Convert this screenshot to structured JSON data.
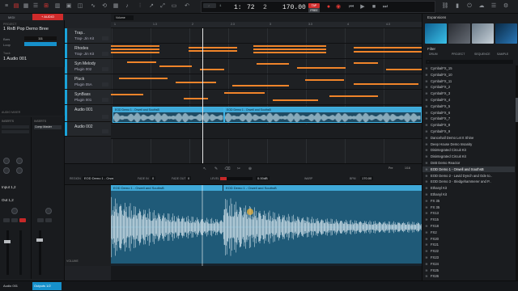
{
  "topbar": {
    "midi_tab": "MIDI",
    "audio_tab": "+ AUDIO",
    "volume_label": "Volume",
    "bars": "1:",
    "beats": "72",
    "ticks": "2",
    "bar_small": "1",
    "bpm": "170.00",
    "tap_label": "TAP",
    "tempo_label": "FREE",
    "accent": "#d12e2e"
  },
  "left": {
    "project_label": "1 RnB Pop Demo Bree",
    "bars_label": "Bars",
    "bars_value": "111",
    "loop_label": "Loop",
    "track_label": "Track",
    "track_value": "1 Audio 001",
    "inserts1": "INSERTS",
    "inserts2": "INSERTS",
    "comp_label": "Comp Master",
    "input_label": "Input 1,2",
    "out_label": "Out 1,2",
    "audio_mixer_label": "AUDIO MIXER"
  },
  "tracks": [
    {
      "name": "Trap..",
      "sub": "Trap-.Jin Kit",
      "color": "#1aa3d9"
    },
    {
      "name": "Rhodes",
      "sub": "Trap-.Jin Kit",
      "color": "#1aa3d9"
    },
    {
      "name": "Syn Melody",
      "sub": "Plugin 002",
      "color": "#1aa3d9"
    },
    {
      "name": "Pluck",
      "sub": "Plugin 05A",
      "color": "#1aa3d9"
    },
    {
      "name": "SynBass",
      "sub": "Plugin 001",
      "color": "#1aa3d9"
    },
    {
      "name": "Audio 001",
      "sub": "",
      "color": "#1aa3d9"
    },
    {
      "name": "Audio 002",
      "sub": "",
      "color": "#1aa3d9"
    }
  ],
  "sequencer": {
    "ruler": [
      "1",
      "1.3",
      "2",
      "2.3",
      "3",
      "3.3",
      "4",
      "4.3"
    ],
    "clip1": "EOD Demo 1 - Orwell and SouthsB",
    "clip2": "EOD Demo 1 - Orwell and SouthsB",
    "audio_label": "AUDIO",
    "programs_label": "PROGRAMS"
  },
  "editbar": {
    "region_label": "REGION",
    "region_value": "EOD Demo 1 - Orwell and ...",
    "fade_in_label": "FADE IN",
    "fade_in_value": "0",
    "fade_out_label": "FADE OUT",
    "fade_out_value": "0",
    "level_label": "LEVEL",
    "level_value": "0.00dB",
    "warp_label": "WARP",
    "bpm_label": "BPM",
    "bpm_value": "170.00",
    "mode": "Pre",
    "rate": "1/16"
  },
  "editor": {
    "clip1": "EOD Demo 1 - Orwell and SouthsB",
    "clip2": "EOD Demo 1 - Orwell and SouthsB",
    "volume_label": "VOLUME"
  },
  "footer": {
    "left": "Audio 001",
    "mid": "Outputs 1/2"
  },
  "right": {
    "expansions_label": "Expansions",
    "filter_label": "Filter",
    "filter_tabs": [
      "DRUM",
      "PROJECT",
      "SEQUENCE",
      "SAMPLE"
    ],
    "path": "..",
    "items": [
      {
        "label": "CymbalFX_15",
        "icon": "wave"
      },
      {
        "label": "CymbalFX_10",
        "icon": "wave"
      },
      {
        "label": "CymbalFX_11",
        "icon": "wave"
      },
      {
        "label": "CymbalFX_2",
        "icon": "wave"
      },
      {
        "label": "CymbalFX_3",
        "icon": "wave"
      },
      {
        "label": "CymbalFX_4",
        "icon": "wave"
      },
      {
        "label": "CymbalFX_5",
        "icon": "wave"
      },
      {
        "label": "CymbalFX_6",
        "icon": "wave"
      },
      {
        "label": "CymbalFX_7",
        "icon": "wave"
      },
      {
        "label": "CymbalFX_8",
        "icon": "wave"
      },
      {
        "label": "CymbalFX_9",
        "icon": "wave"
      },
      {
        "label": "Dancehall Demo Let It Shine",
        "icon": "wave"
      },
      {
        "label": "Deep House Demo Insanity",
        "icon": "wave"
      },
      {
        "label": "Disintegrated Circuit Kit",
        "icon": "wave"
      },
      {
        "label": "Disintegrated Circuit Kit",
        "icon": "wave"
      },
      {
        "label": "DnB Demo Reactor",
        "icon": "wave"
      },
      {
        "label": "EOD Demo 1 - Orwell and SouthsB",
        "icon": "wave",
        "selected": true
      },
      {
        "label": "EOD Demo 2 - Lavid Dynch and Ode to..",
        "icon": "wave"
      },
      {
        "label": "EOD Demo 3 - Sledgehammerer and P..",
        "icon": "wave"
      },
      {
        "label": "Ethanyl Kit",
        "icon": "wave"
      },
      {
        "label": "Ethanyl Kit",
        "icon": "wave"
      },
      {
        "label": "FX 35",
        "icon": "wave"
      },
      {
        "label": "FX 35",
        "icon": "wave"
      },
      {
        "label": "FX13",
        "icon": "wave"
      },
      {
        "label": "FX15",
        "icon": "wave"
      },
      {
        "label": "FX18",
        "icon": "wave"
      },
      {
        "label": "FX2",
        "icon": "wave"
      },
      {
        "label": "FX20",
        "icon": "wave"
      },
      {
        "label": "FX21",
        "icon": "wave"
      },
      {
        "label": "FX22",
        "icon": "wave"
      },
      {
        "label": "FX23",
        "icon": "wave"
      },
      {
        "label": "FX24",
        "icon": "wave"
      },
      {
        "label": "FX25",
        "icon": "wave"
      },
      {
        "label": "FX26",
        "icon": "wave"
      }
    ]
  }
}
